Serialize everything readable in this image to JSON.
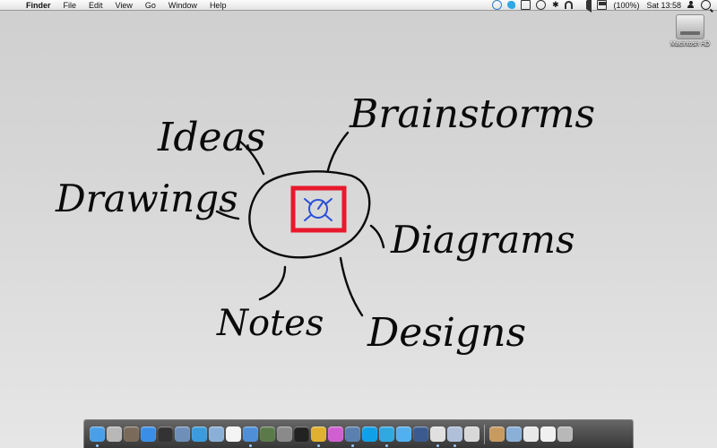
{
  "menubar": {
    "apple_glyph": "",
    "menus": [
      "Finder",
      "File",
      "Edit",
      "View",
      "Go",
      "Window",
      "Help"
    ],
    "battery_text": "(100%)",
    "clock": "Sat 13:58"
  },
  "desktop": {
    "hd_label": "Macintosh HD"
  },
  "sketch": {
    "words": {
      "ideas": "Ideas",
      "brainstorms": "Brainstorms",
      "drawings": "Drawings",
      "diagrams": "Diagrams",
      "notes": "Notes",
      "designs": "Designs"
    },
    "colors": {
      "ink": "#0a0a0a",
      "square": "#e8192c",
      "logo": "#2a4fd6"
    }
  },
  "dock": {
    "apps": [
      {
        "name": "finder-icon",
        "color": "#4aa0e8"
      },
      {
        "name": "launchpad-icon",
        "color": "#b8b8b8"
      },
      {
        "name": "mission-control-icon",
        "color": "#7a6a5a"
      },
      {
        "name": "app-store-icon",
        "color": "#3a8ee6"
      },
      {
        "name": "dashboard-icon",
        "color": "#333333"
      },
      {
        "name": "preview-icon",
        "color": "#6d8fb8"
      },
      {
        "name": "safari-icon",
        "color": "#3c9bdc"
      },
      {
        "name": "mail-icon",
        "color": "#8ab0d8"
      },
      {
        "name": "calendar-icon",
        "color": "#f4f4f4"
      },
      {
        "name": "itunes-icon",
        "color": "#4e8fd8"
      },
      {
        "name": "iphoto-icon",
        "color": "#5b7a4a"
      },
      {
        "name": "preferences-icon",
        "color": "#8a8a8a"
      },
      {
        "name": "terminal-icon",
        "color": "#222222"
      },
      {
        "name": "chrome-icon",
        "color": "#e0b030"
      },
      {
        "name": "flower-app-icon",
        "color": "#d060d0"
      },
      {
        "name": "xcode-icon",
        "color": "#5a80b0"
      },
      {
        "name": "skype-icon",
        "color": "#10a0e8"
      },
      {
        "name": "twitter-icon",
        "color": "#30a8e0"
      },
      {
        "name": "icloud-icon",
        "color": "#50b0f0"
      },
      {
        "name": "quicktime-icon",
        "color": "#3a5a90"
      },
      {
        "name": "reminders-icon",
        "color": "#e0e0e0"
      },
      {
        "name": "compass-app-icon",
        "color": "#b0c0d8"
      },
      {
        "name": "grapher-icon",
        "color": "#d8d8d8"
      }
    ],
    "stacks": [
      {
        "name": "applications-stack-icon",
        "color": "#c89a60"
      },
      {
        "name": "documents-stack-icon",
        "color": "#8ab0d8"
      },
      {
        "name": "downloads-stack-icon",
        "color": "#e8e8e8"
      },
      {
        "name": "text-file-icon",
        "color": "#f0f0f0"
      },
      {
        "name": "trash-icon",
        "color": "#b8b8b8"
      }
    ]
  }
}
